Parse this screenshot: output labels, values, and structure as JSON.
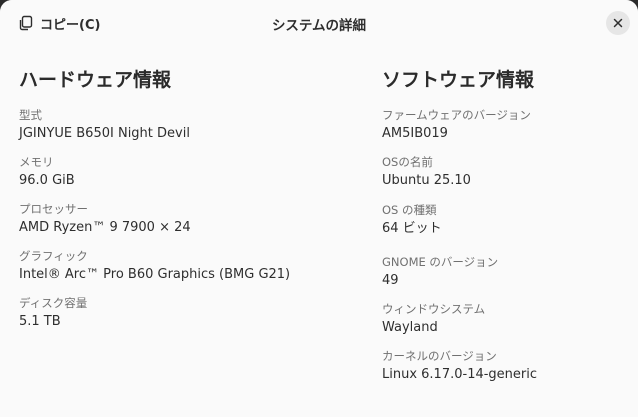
{
  "header": {
    "copy_label": "コピー(C)",
    "title": "システムの詳細"
  },
  "hardware": {
    "title": "ハードウェア情報",
    "fields": [
      {
        "label": "型式",
        "value": "JGINYUE B650I Night Devil"
      },
      {
        "label": "メモリ",
        "value": "96.0 GiB"
      },
      {
        "label": "プロセッサー",
        "value": "AMD Ryzen™ 9 7900 × 24"
      },
      {
        "label": "グラフィック",
        "value": "Intel® Arc™ Pro B60 Graphics (BMG G21)"
      },
      {
        "label": "ディスク容量",
        "value": "5.1 TB"
      }
    ]
  },
  "software": {
    "title": "ソフトウェア情報",
    "fields": [
      {
        "label": "ファームウェアのバージョン",
        "value": "AM5IB019"
      },
      {
        "label": "OSの名前",
        "value": "Ubuntu 25.10"
      },
      {
        "label": "OS の種類",
        "value": "64 ビット"
      },
      {
        "label": "GNOME のバージョン",
        "value": "49"
      },
      {
        "label": "ウィンドウシステム",
        "value": "Wayland"
      },
      {
        "label": "カーネルのバージョン",
        "value": "Linux 6.17.0-14-generic"
      }
    ]
  },
  "colors": {
    "background": "#fafafa",
    "text": "#2e2e2e",
    "label": "#707070",
    "close_button_bg": "#e6e6e6"
  },
  "icons": {
    "copy": "copy-icon",
    "close": "close-icon"
  }
}
